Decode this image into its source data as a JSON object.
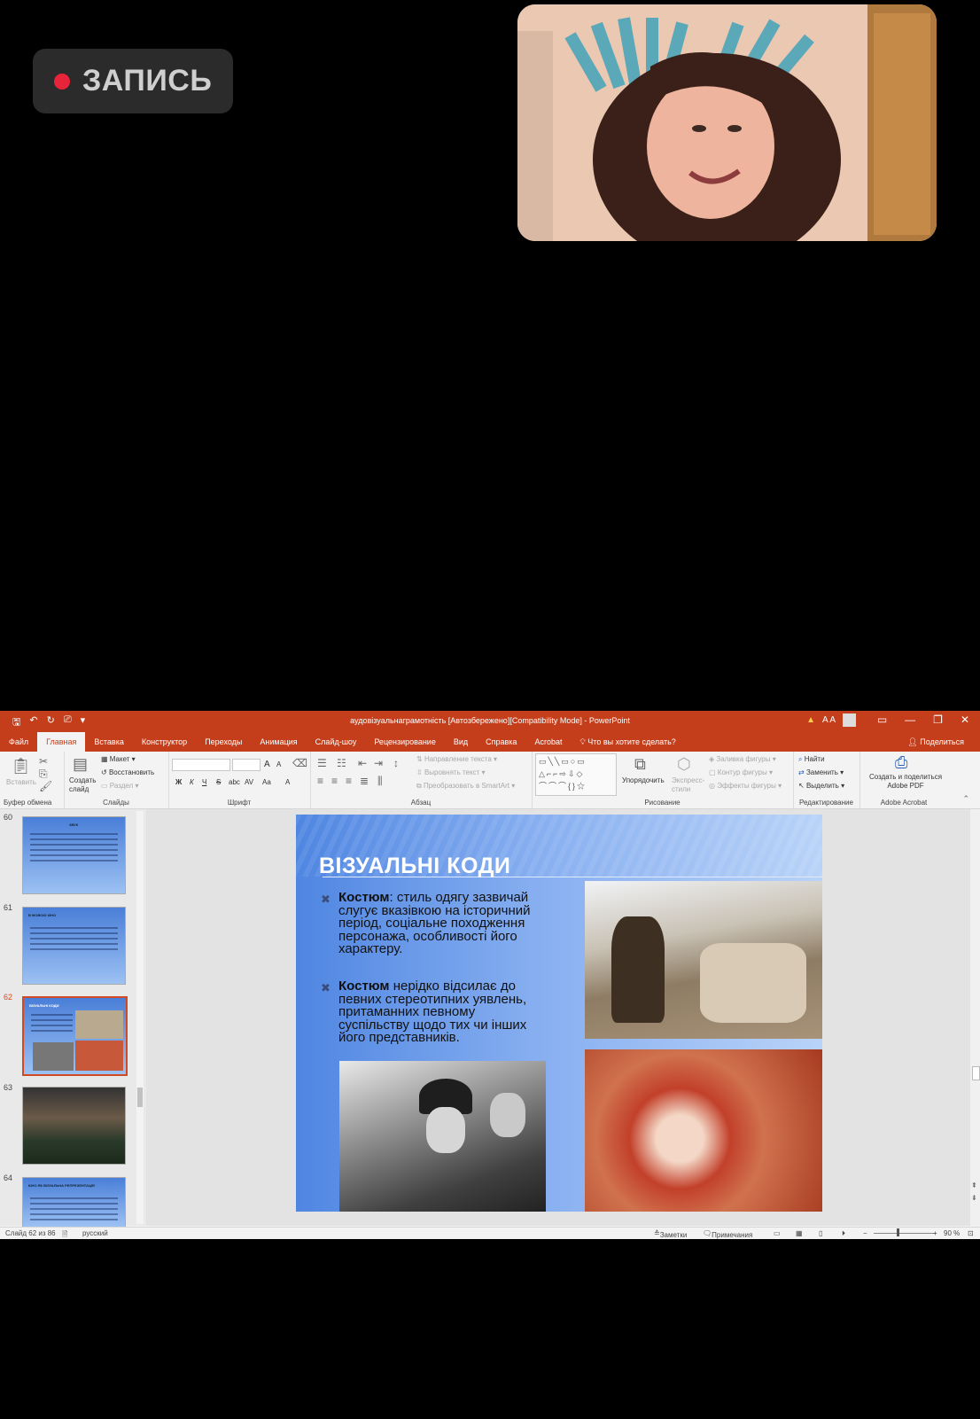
{
  "recording": {
    "label": "ЗАПИСЬ",
    "dot_color": "#e8243a"
  },
  "window": {
    "title": "аудовізуальнаграмотність [Автозбережено][Compatibility Mode] - PowerPoint",
    "accent": "#c43e1c",
    "font_size": "A A"
  },
  "menu": {
    "tabs": [
      "Файл",
      "Главная",
      "Вставка",
      "Конструктор",
      "Переходы",
      "Анимация",
      "Слайд-шоу",
      "Рецензирование",
      "Вид",
      "Справка",
      "Acrobat"
    ],
    "active": "Главная",
    "tell_me": "Что вы хотите сделать?",
    "share": "Поделиться"
  },
  "ribbon": {
    "clipboard": {
      "paste": "Вставить",
      "label": "Буфер обмена"
    },
    "slides": {
      "new_slide": "Создать слайд",
      "layout": "Макет",
      "reset": "Восстановить",
      "section": "Раздел",
      "label": "Слайды"
    },
    "font": {
      "bold": "Ж",
      "italic": "К",
      "underline": "Ч",
      "strike": "S",
      "shadow": "abc",
      "spacing": "AV",
      "case": "Aa",
      "color": "A",
      "grow": "A",
      "shrink": "A",
      "label": "Шрифт"
    },
    "paragraph": {
      "text_direction": "Направление текста",
      "align_text": "Выровнять текст",
      "smartart": "Преобразовать в SmartArt",
      "label": "Абзац"
    },
    "drawing": {
      "arrange": "Упорядочить",
      "quick_styles": "Экспресс-стили",
      "fill": "Заливка фигуры",
      "outline": "Контур фигуры",
      "effects": "Эффекты фигуры",
      "label": "Рисование"
    },
    "editing": {
      "find": "Найти",
      "replace": "Заменить",
      "select": "Выделить",
      "label": "Редактирование"
    },
    "acrobat": {
      "create": "Создать и поделиться Adobe PDF",
      "label": "Adobe Acrobat"
    }
  },
  "thumbnails": [
    {
      "num": "60",
      "title": "ЗВУК"
    },
    {
      "num": "61",
      "title": "В МОВОЮ КІНО"
    },
    {
      "num": "62",
      "title": "ВІЗУАЛЬНІ КОДИ"
    },
    {
      "num": "63",
      "title": ""
    },
    {
      "num": "64",
      "title": "КІНО ЯК ВІЗУАЛЬНА РЕПРЕЗЕНТАЦІЯ"
    }
  ],
  "selected_slide": "62",
  "slide": {
    "title": "ВІЗУАЛЬНІ КОДИ",
    "bullet1_bold": "Костюм",
    "bullet1_text": ": стиль одягу зазвичай слугує вказівкою на історичний період, соціальне походження персонажа, особливості його характеру.",
    "bullet2_bold": "Костюм",
    "bullet2_text": " нерідко відсилає до певних стереотипних уявлень, притаманних певному суспільству щодо тих чи інших його представників."
  },
  "status": {
    "slide_info": "Слайд 62 из 86",
    "language": "русский",
    "notes": "Заметки",
    "comments": "Примечания",
    "zoom": "90 %"
  }
}
